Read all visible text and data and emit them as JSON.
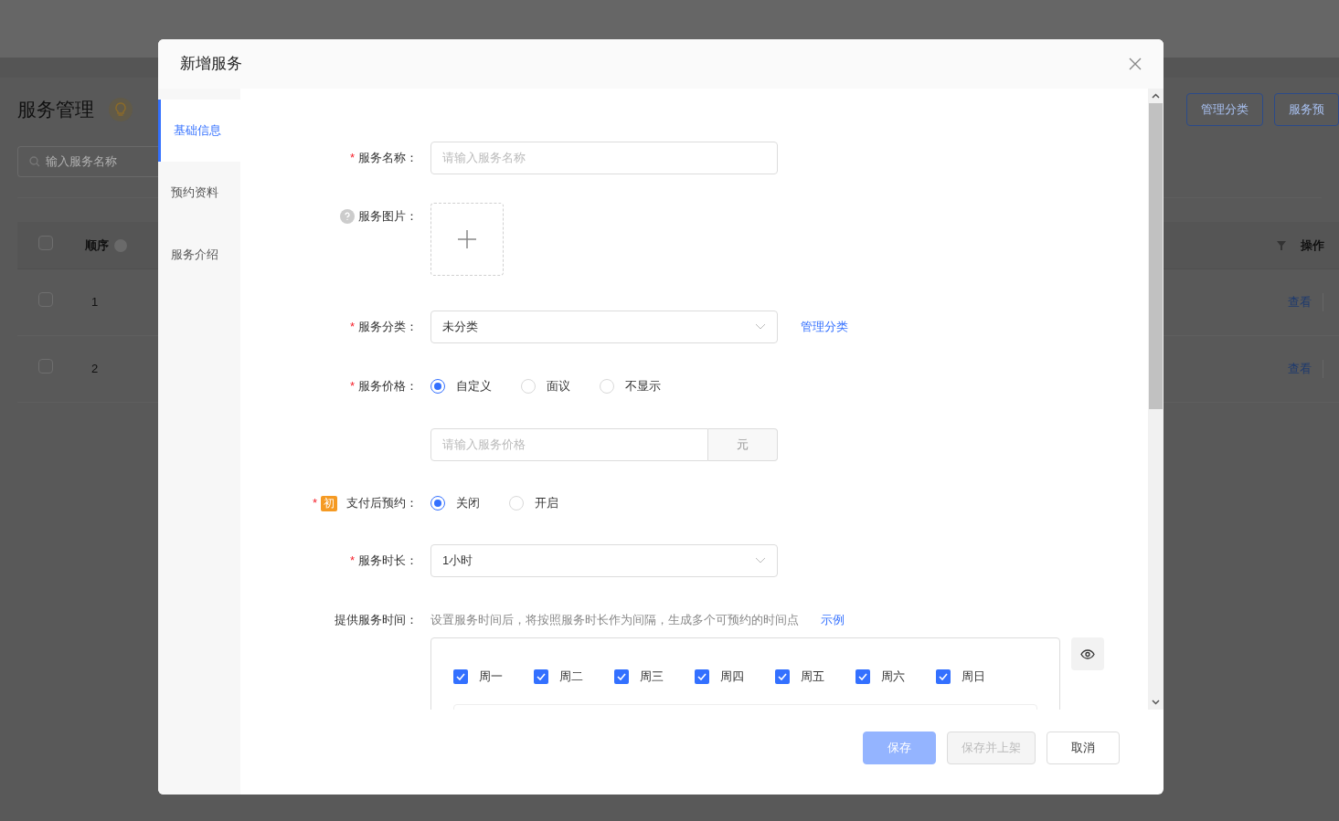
{
  "background_page": {
    "title": "服务管理",
    "search": {
      "placeholder": "输入服务名称"
    },
    "buttons": [
      "管理分类",
      "服务预"
    ],
    "table": {
      "select_all_checked": false,
      "columns": [
        {
          "label": "顺序"
        },
        {
          "label": "操作"
        }
      ],
      "rows": [
        {
          "order": "1",
          "action": "查看",
          "checked": false
        },
        {
          "order": "2",
          "action": "查看",
          "checked": false
        }
      ]
    }
  },
  "dialog": {
    "title": "新增服务",
    "tabs": [
      {
        "label": "基础信息",
        "selected": true
      },
      {
        "label": "预约资料",
        "selected": false
      },
      {
        "label": "服务介绍",
        "selected": false
      }
    ],
    "form": {
      "name": {
        "label": "服务名称：",
        "required_mark": "*",
        "placeholder": "请输入服务名称"
      },
      "image": {
        "label": "服务图片："
      },
      "category": {
        "label": "服务分类：",
        "required_mark": "*",
        "value": "未分类",
        "link": "管理分类"
      },
      "price": {
        "label": "服务价格：",
        "required_mark": "*",
        "options": [
          {
            "label": "自定义",
            "selected": true
          },
          {
            "label": "面议",
            "selected": false
          },
          {
            "label": "不显示",
            "selected": false
          }
        ],
        "placeholder": "请输入服务价格",
        "unit": "元"
      },
      "pay_first": {
        "label": "支付后预约：",
        "required_mark": "*",
        "badge": "初",
        "options": [
          {
            "label": "关闭",
            "selected": true
          },
          {
            "label": "开启",
            "selected": false
          }
        ]
      },
      "duration": {
        "label": "服务时长：",
        "required_mark": "*",
        "value": "1小时"
      },
      "service_time": {
        "label": "提供服务时间：",
        "hint": "设置服务时间后，将按照服务时长作为间隔，生成多个可预约的时间点",
        "link": "示例",
        "days": [
          {
            "label": "周一",
            "checked": true
          },
          {
            "label": "周二",
            "checked": true
          },
          {
            "label": "周三",
            "checked": true
          },
          {
            "label": "周四",
            "checked": true
          },
          {
            "label": "周五",
            "checked": true
          },
          {
            "label": "周六",
            "checked": true
          },
          {
            "label": "周日",
            "checked": true
          }
        ]
      }
    },
    "footer_buttons": [
      {
        "label": "保存",
        "kind": "primary",
        "disabled": true
      },
      {
        "label": "保存并上架",
        "kind": "default",
        "disabled": true
      },
      {
        "label": "取消",
        "kind": "default",
        "disabled": false
      }
    ]
  }
}
